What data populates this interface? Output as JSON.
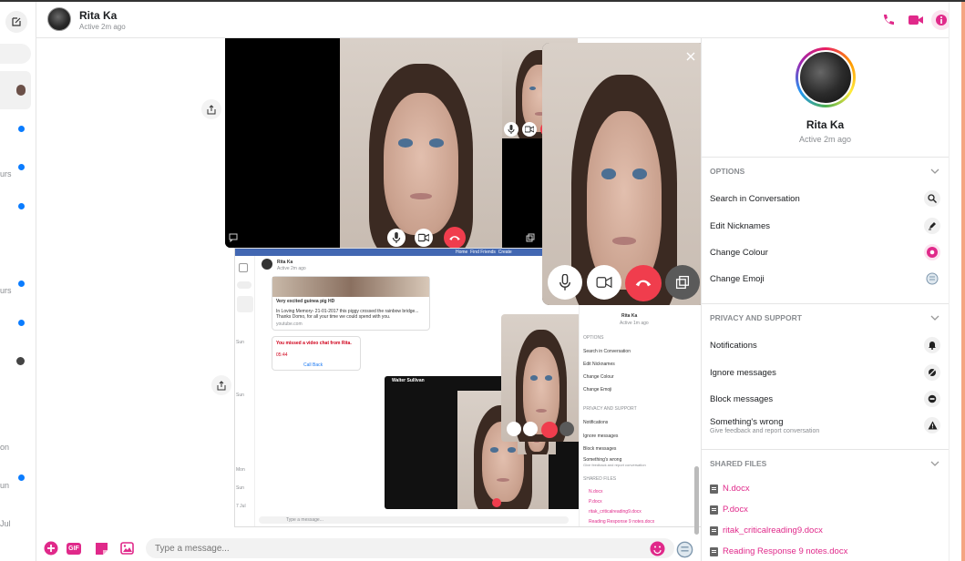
{
  "app": {
    "accent_color": "#e0298a",
    "end_call_color": "#f03d4d"
  },
  "sidebar": {
    "clipped_labels": [
      "urs",
      "urs",
      "on",
      "un",
      "Jul"
    ]
  },
  "header": {
    "name": "Rita Ka",
    "status": "Active 2m ago",
    "icons": [
      "phone-icon",
      "video-camera-icon",
      "info-icon"
    ]
  },
  "nested": {
    "header_name": "Rita Ka",
    "header_status": "Active 2m ago",
    "nav": [
      "Home",
      "Find Friends",
      "Create"
    ],
    "msg1_title": "Very excited guinea pig HD",
    "msg1_body": "In Loving Memory- 21-01-2017 this piggy crossed the rainbow bridge... Thanks Domo, for all your time we could spend with you.",
    "msg1_source": "youtube.com",
    "missed_call": "You missed a video chat from Rita.",
    "missed_time": "05:44",
    "call_back": "Call Back",
    "video_name": "Walter Sullivan",
    "panel_name": "Rita Ka",
    "panel_status": "Active 1m ago",
    "options_title": "OPTIONS",
    "options": [
      "Search in Conversation",
      "Edit Nicknames",
      "Change Colour",
      "Change Emoji"
    ],
    "privacy_title": "PRIVACY AND SUPPORT",
    "privacy": [
      "Notifications",
      "Ignore messages",
      "Block messages",
      "Something's wrong"
    ],
    "privacy_sub": "Give feedback and report conversation",
    "files_title": "SHARED FILES",
    "files": [
      "N.docx",
      "P.docx",
      "ritak_criticalreading9.docx",
      "Reading Response 9 notes.docx"
    ],
    "composer_placeholder": "Type a message...",
    "sidebar_labels": [
      "Sun",
      "Sun",
      "Mon",
      "Sun",
      "7 Jul"
    ]
  },
  "right_panel": {
    "name": "Rita Ka",
    "status": "Active 2m ago",
    "options": {
      "title": "OPTIONS",
      "items": [
        {
          "label": "Search in Conversation",
          "icon": "search-icon"
        },
        {
          "label": "Edit Nicknames",
          "icon": "pencil-icon"
        },
        {
          "label": "Change Colour",
          "icon": "colour-icon"
        },
        {
          "label": "Change Emoji",
          "icon": "emoji-icon"
        }
      ]
    },
    "privacy": {
      "title": "PRIVACY AND SUPPORT",
      "items": [
        {
          "label": "Notifications",
          "icon": "bell-icon"
        },
        {
          "label": "Ignore messages",
          "icon": "ignore-icon"
        },
        {
          "label": "Block messages",
          "icon": "block-icon"
        },
        {
          "label": "Something's wrong",
          "sub": "Give feedback and report conversation",
          "icon": "warning-icon"
        }
      ]
    },
    "files": {
      "title": "SHARED FILES",
      "items": [
        "N.docx",
        "P.docx",
        "ritak_criticalreading9.docx",
        "Reading Response 9 notes.docx"
      ]
    }
  },
  "composer": {
    "placeholder": "Type a message...",
    "buttons": [
      "plus-icon",
      "gif-icon",
      "sticker-icon",
      "image-icon"
    ],
    "gif_label": "GIF"
  }
}
